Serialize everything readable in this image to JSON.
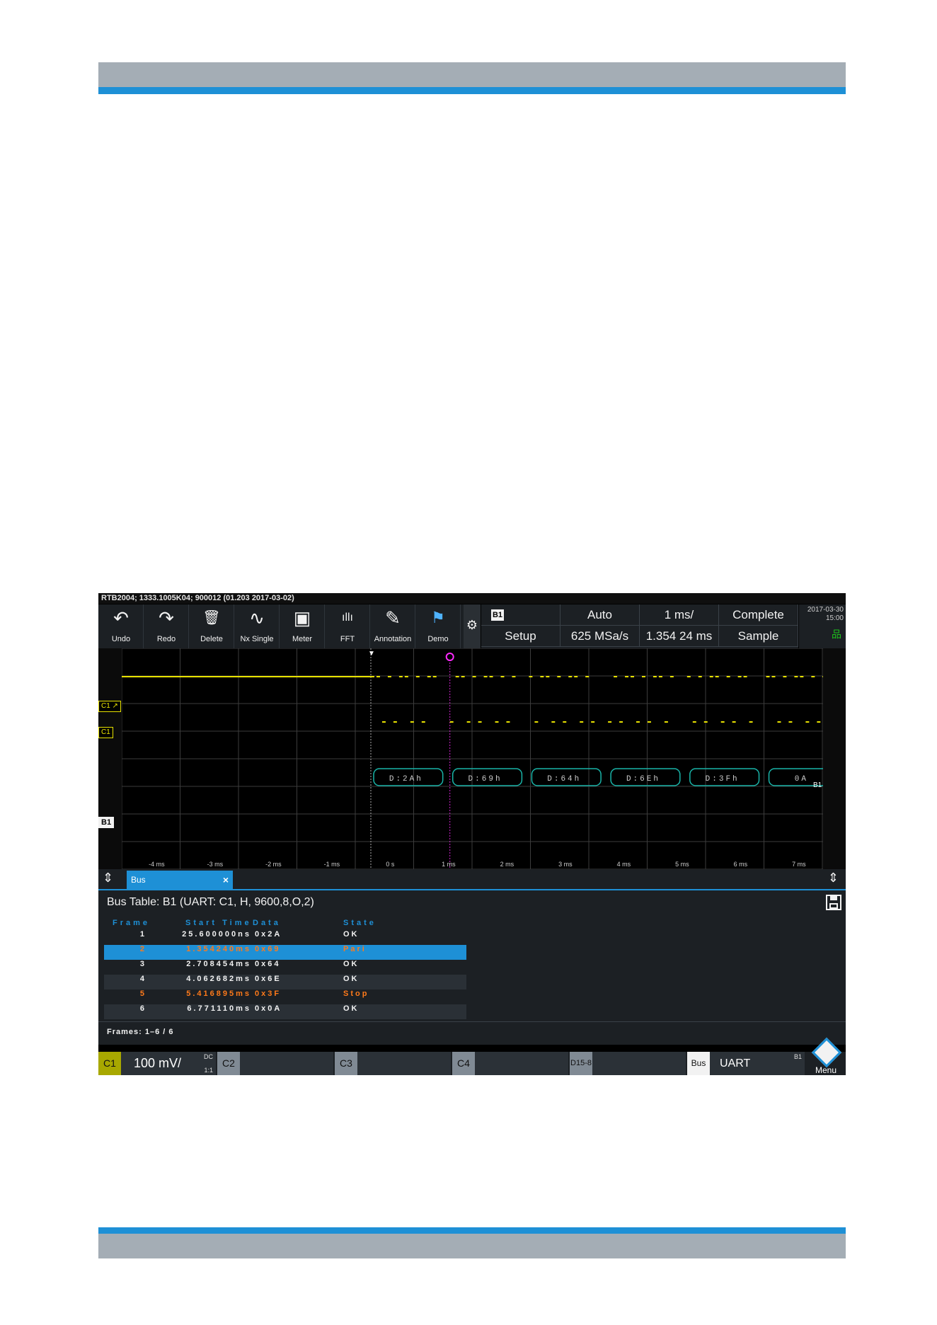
{
  "title_bar": "RTB2004; 1333.1005K04; 900012 (01.203 2017-03-02)",
  "toolbar": [
    {
      "label": "Undo",
      "icon": "undo-icon",
      "glyph": "↶"
    },
    {
      "label": "Redo",
      "icon": "redo-icon",
      "glyph": "↷"
    },
    {
      "label": "Delete",
      "icon": "trash-icon",
      "glyph": "🗑"
    },
    {
      "label": "Nx Single",
      "icon": "nx-single-icon",
      "glyph": "∿"
    },
    {
      "label": "Meter",
      "icon": "meter-icon",
      "glyph": "▣"
    },
    {
      "label": "FFT",
      "icon": "fft-icon",
      "glyph": "ıllı"
    },
    {
      "label": "Annotation",
      "icon": "pencil-icon",
      "glyph": "✎"
    },
    {
      "label": "Demo",
      "icon": "demo-icon",
      "glyph": "⚑"
    }
  ],
  "params": {
    "bus_tag": "B1",
    "trigger_mode": "Auto",
    "timebase": "1 ms/",
    "acq_state": "Complete",
    "setup": "Setup",
    "sample_rate": "625 MSa/s",
    "position": "1.354 24 ms",
    "acq_mode": "Sample",
    "date": "2017-03-30",
    "time": "15:00"
  },
  "markers": {
    "c1_trigger": "C1 ↗",
    "c1": "C1",
    "b1": "B1",
    "b1_right": "B1"
  },
  "decode_labels": [
    "D:2Ah",
    "D:69h",
    "D:64h",
    "D:6Eh",
    "D:3Fh",
    "0A"
  ],
  "x_ticks": [
    "-4 ms",
    "-3 ms",
    "-2 ms",
    "-1 ms",
    "0 s",
    "1 ms",
    "2 ms",
    "3 ms",
    "4 ms",
    "5 ms",
    "6 ms",
    "7 ms"
  ],
  "tab": {
    "label": "Bus",
    "close": "×"
  },
  "bus_table": {
    "title": "Bus Table: B1 (UART: C1, H, 9600,8,O,2)",
    "columns": [
      "Frame",
      "Start Time",
      "Data",
      "State"
    ],
    "rows": [
      {
        "frame": "1",
        "start": "25.600000ns",
        "data": "0x2A",
        "state": "OK"
      },
      {
        "frame": "2",
        "start": "1.354240ms",
        "data": "0x69",
        "state": "Pari"
      },
      {
        "frame": "3",
        "start": "2.708454ms",
        "data": "0x64",
        "state": "OK"
      },
      {
        "frame": "4",
        "start": "4.062682ms",
        "data": "0x6E",
        "state": "OK"
      },
      {
        "frame": "5",
        "start": "5.416895ms",
        "data": "0x3F",
        "state": "Stop"
      },
      {
        "frame": "6",
        "start": "6.771110ms",
        "data": "0x0A",
        "state": "OK"
      }
    ],
    "frames_info": "Frames: 1–6 / 6"
  },
  "channel_bar": {
    "c1": {
      "tag": "C1",
      "value": "100 mV/",
      "coupling": "DC",
      "ratio": "1:1"
    },
    "c2": {
      "tag": "C2"
    },
    "c3": {
      "tag": "C3"
    },
    "c4": {
      "tag": "C4"
    },
    "digital": {
      "tag": "D15-8"
    },
    "bus": {
      "tag": "Bus",
      "value": "UART",
      "index": "B1"
    },
    "menu": "Menu"
  },
  "colors": {
    "accent": "#1e90d6",
    "trace": "#e8e200",
    "bus": "#19b4a8",
    "error": "#ff7a1a"
  }
}
